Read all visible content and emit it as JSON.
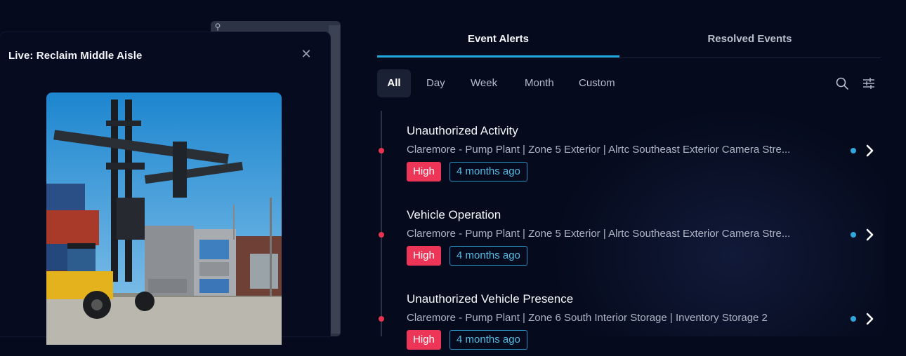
{
  "popup": {
    "title": "Live: Reclaim Middle Aisle",
    "close_icon": "close-icon"
  },
  "tabs": [
    {
      "label": "Event Alerts",
      "active": true
    },
    {
      "label": "Resolved Events",
      "active": false
    }
  ],
  "filters": [
    {
      "label": "All",
      "active": true
    },
    {
      "label": "Day",
      "active": false
    },
    {
      "label": "Week",
      "active": false
    },
    {
      "label": "Month",
      "active": false
    },
    {
      "label": "Custom",
      "active": false
    }
  ],
  "tools": {
    "search_icon": "search-icon",
    "filter_icon": "sliders-icon"
  },
  "events": [
    {
      "title": "Unauthorized Activity",
      "meta": "Claremore - Pump Plant  |  Zone 5 Exterior  |  Alrtc Southeast Exterior Camera Stre...",
      "severity": "High",
      "time": "4 months ago"
    },
    {
      "title": "Vehicle Operation",
      "meta": "Claremore - Pump Plant  |  Zone 5 Exterior  |  Alrtc Southeast Exterior Camera Stre...",
      "severity": "High",
      "time": "4 months ago"
    },
    {
      "title": "Unauthorized Vehicle Presence",
      "meta": "Claremore - Pump Plant  |  Zone 6 South Interior Storage  |  Inventory Storage 2",
      "severity": "High",
      "time": "4 months ago"
    }
  ],
  "colors": {
    "accent": "#1ea7d8",
    "severity_high": "#ed3558",
    "background": "#050a1c"
  }
}
